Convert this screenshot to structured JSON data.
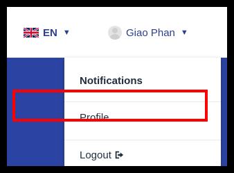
{
  "header": {
    "language_label": "EN",
    "language_flag_icon": "uk-flag-icon",
    "language_caret_icon": "caret-down-icon",
    "user_name": "Giao Phan",
    "user_avatar_icon": "user-avatar-icon",
    "user_caret_icon": "caret-down-icon"
  },
  "dropdown": {
    "items": [
      {
        "label": "Notifications"
      },
      {
        "label": "Profile"
      },
      {
        "label": "Logout",
        "icon": "sign-out-icon"
      }
    ]
  },
  "colors": {
    "accent_text": "#2c3e8f",
    "nav_blue": "#2b44a3",
    "highlight": "#ff0000",
    "outer_frame": "#000000"
  }
}
